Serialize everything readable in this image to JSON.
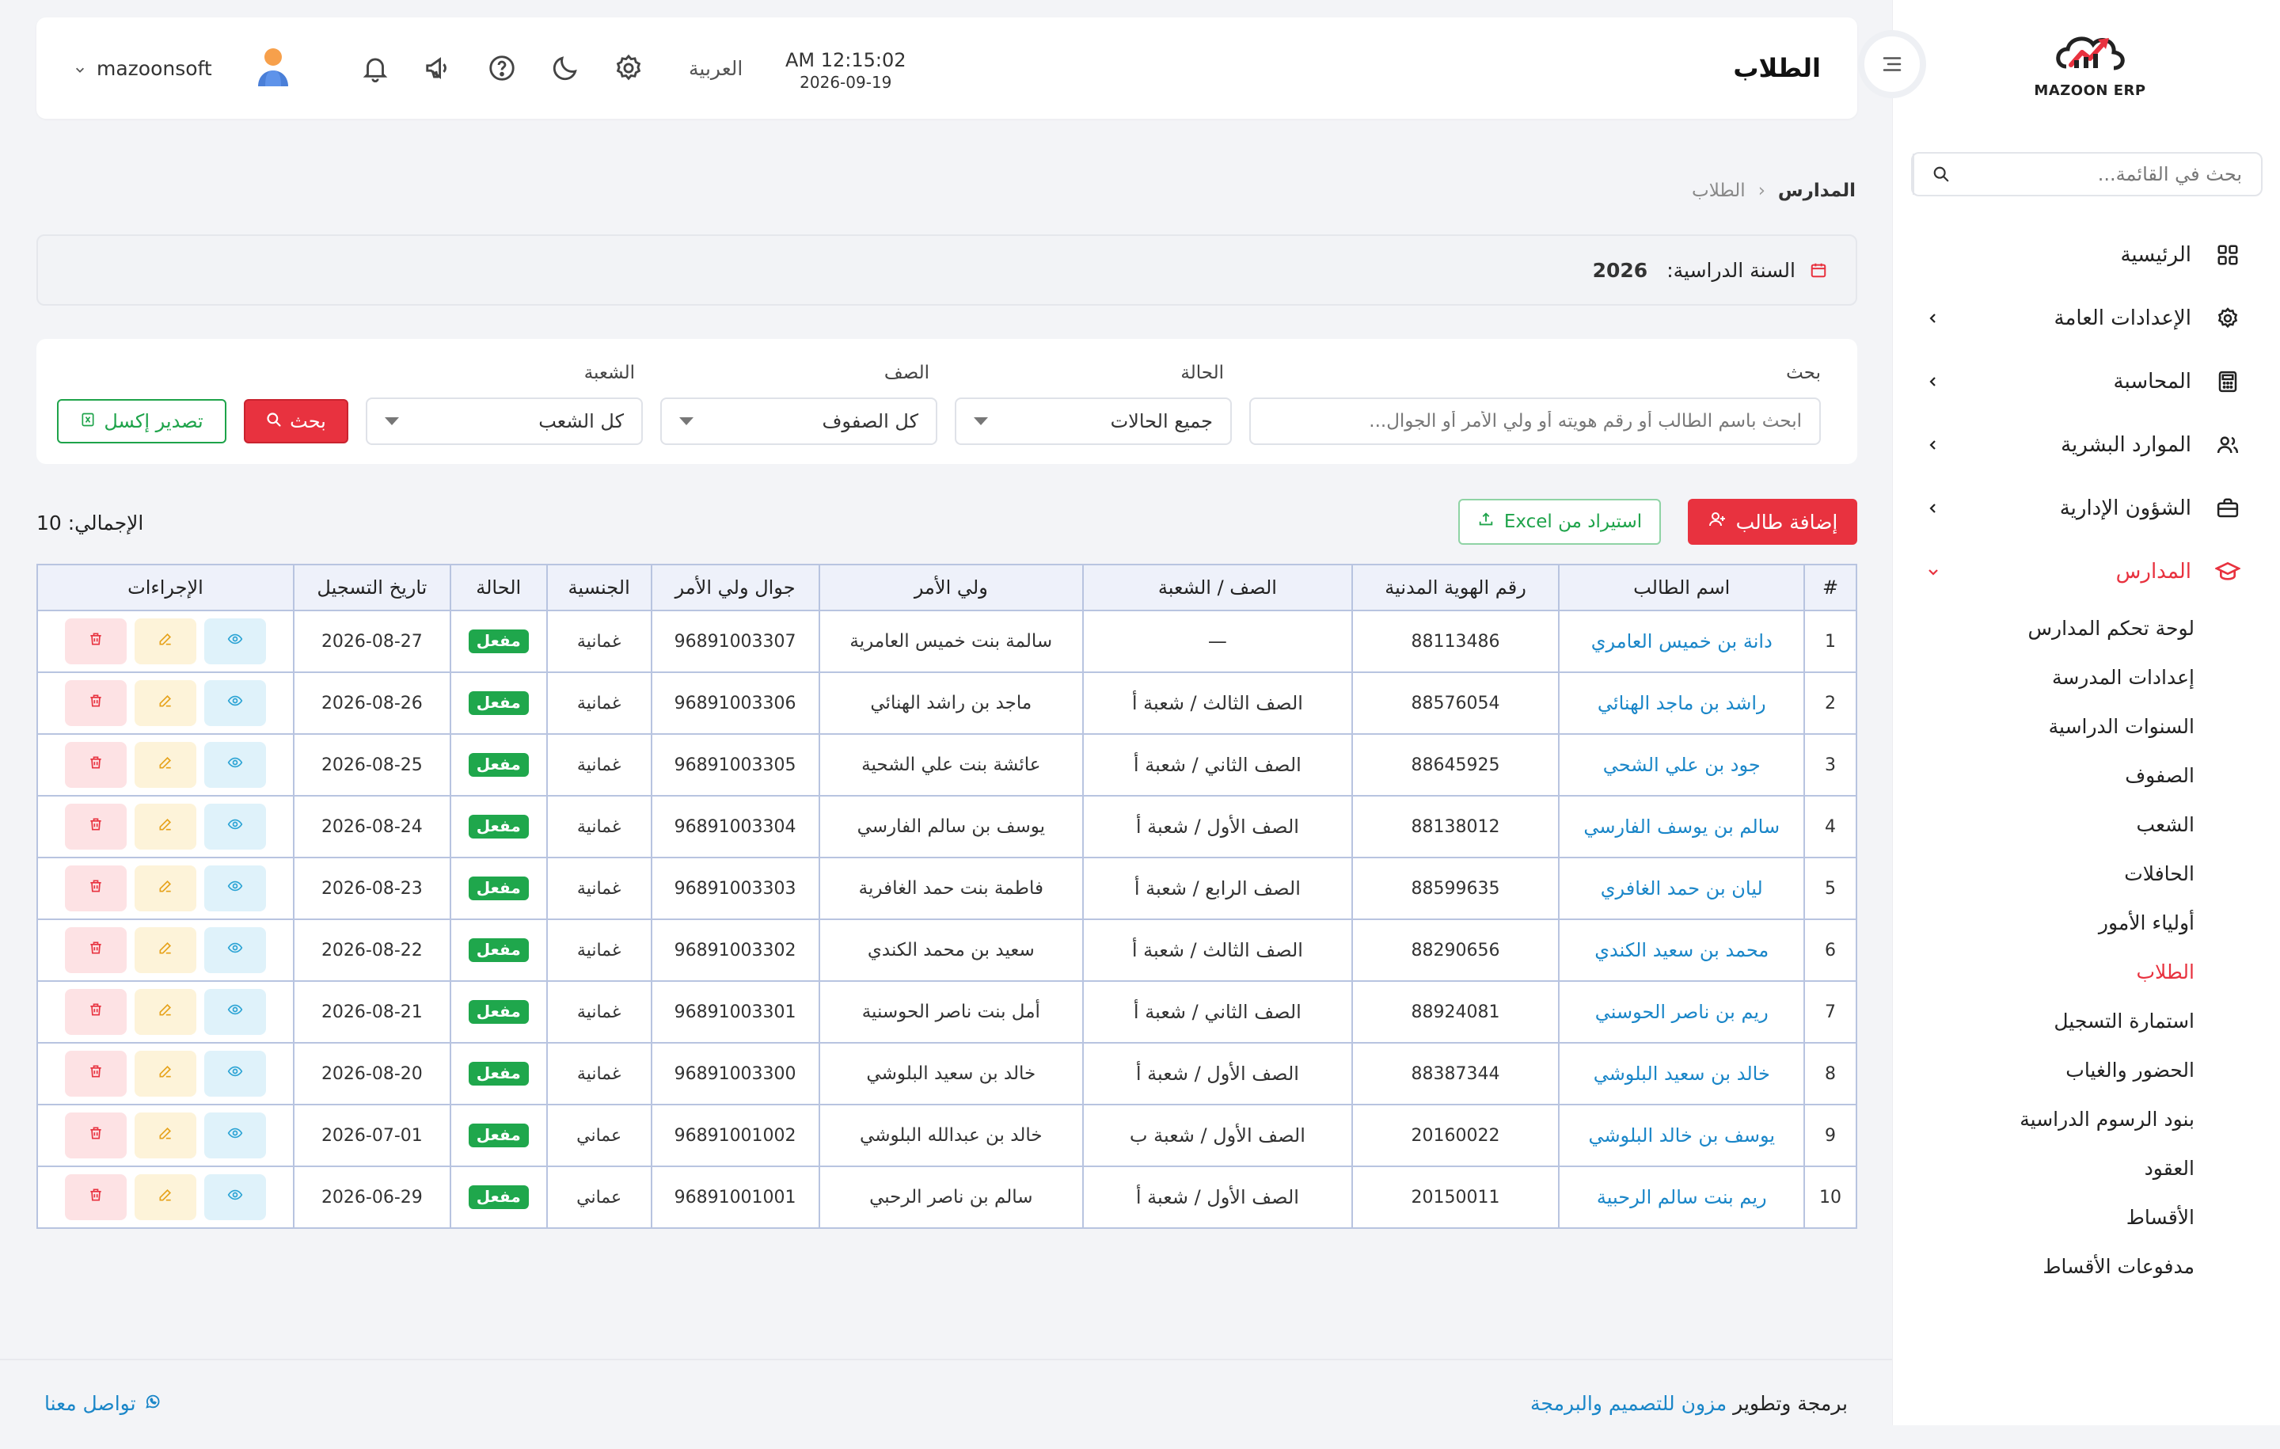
{
  "brand": {
    "name": "MAZOON ERP",
    "tagline": "ERP"
  },
  "colors": {
    "accent": "#e8323f",
    "success": "#1fa74c",
    "link": "#1a86c8",
    "header_row": "#eef1fa"
  },
  "sidebar": {
    "search_placeholder": "بحث في القائمة...",
    "items": [
      {
        "label": "الرئيسية",
        "icon": "grid-icon",
        "has_children": false
      },
      {
        "label": "الإعدادات العامة",
        "icon": "gear-icon",
        "has_children": true
      },
      {
        "label": "المحاسبة",
        "icon": "calculator-icon",
        "has_children": true
      },
      {
        "label": "الموارد البشرية",
        "icon": "users-icon",
        "has_children": true
      },
      {
        "label": "الشؤون الإدارية",
        "icon": "briefcase-icon",
        "has_children": true
      },
      {
        "label": "المدارس",
        "icon": "graduation-cap-icon",
        "has_children": true,
        "expanded": true
      }
    ],
    "schools_sub": [
      "لوحة تحكم المدارس",
      "إعدادات المدرسة",
      "السنوات الدراسية",
      "الصفوف",
      "الشعب",
      "الحافلات",
      "أولياء الأمور",
      "الطلاب",
      "استمارة التسجيل",
      "الحضور والغياب",
      "بنود الرسوم الدراسية",
      "العقود",
      "الأقساط",
      "مدفوعات الأقساط"
    ],
    "active_sub": "الطلاب"
  },
  "topbar": {
    "title": "الطلاب",
    "time": "AM 12:15:02",
    "date": "2026-09-19",
    "language": "العربية",
    "username": "mazoonsoft"
  },
  "breadcrumb": {
    "root": "المدارس",
    "current": "الطلاب"
  },
  "year": {
    "label": "السنة الدراسية:",
    "value": "2026"
  },
  "filters": {
    "search_label": "بحث",
    "search_placeholder": "ابحث باسم الطالب أو رقم هويته أو ولي الأمر أو الجوال...",
    "status_label": "الحالة",
    "status_value": "جميع الحالات",
    "class_label": "الصف",
    "class_value": "كل الصفوف",
    "section_label": "الشعبة",
    "section_value": "كل الشعب",
    "search_button": "بحث",
    "export_button": "تصدير إكسل"
  },
  "actions": {
    "add_button": "إضافة طالب",
    "import_button": "استيراد من Excel",
    "total": "الإجمالي: 10"
  },
  "table": {
    "headers": [
      "#",
      "اسم الطالب",
      "رقم الهوية المدنية",
      "الصف / الشعبة",
      "ولي الأمر",
      "جوال ولي الأمر",
      "الجنسية",
      "الحالة",
      "تاريخ التسجيل",
      "الإجراءات"
    ],
    "rows": [
      {
        "n": "1",
        "name": "دانة بن خميس العامري",
        "id": "88113486",
        "cls": "—",
        "guardian": "سالمة بنت خميس العامرية",
        "phone": "96891003307",
        "nat": "غمانية",
        "status": "مفعل",
        "date": "2026-08-27"
      },
      {
        "n": "2",
        "name": "راشد بن ماجد الهنائي",
        "id": "88576054",
        "cls": "الصف الثالث  /  شعبة أ",
        "guardian": "ماجد بن راشد الهنائي",
        "phone": "96891003306",
        "nat": "غمانية",
        "status": "مفعل",
        "date": "2026-08-26"
      },
      {
        "n": "3",
        "name": "جود بن علي الشحي",
        "id": "88645925",
        "cls": "الصف الثاني  /  شعبة أ",
        "guardian": "عائشة بنت علي الشحية",
        "phone": "96891003305",
        "nat": "غمانية",
        "status": "مفعل",
        "date": "2026-08-25"
      },
      {
        "n": "4",
        "name": "سالم بن يوسف الفارسي",
        "id": "88138012",
        "cls": "الصف الأول  /  شعبة أ",
        "guardian": "يوسف بن سالم الفارسي",
        "phone": "96891003304",
        "nat": "غمانية",
        "status": "مفعل",
        "date": "2026-08-24"
      },
      {
        "n": "5",
        "name": "ليان بن حمد الغافري",
        "id": "88599635",
        "cls": "الصف الرابع  /  شعبة أ",
        "guardian": "فاطمة بنت حمد الغافرية",
        "phone": "96891003303",
        "nat": "غمانية",
        "status": "مفعل",
        "date": "2026-08-23"
      },
      {
        "n": "6",
        "name": "محمد بن سعيد الكندي",
        "id": "88290656",
        "cls": "الصف الثالث  /  شعبة أ",
        "guardian": "سعيد بن محمد الكندي",
        "phone": "96891003302",
        "nat": "غمانية",
        "status": "مفعل",
        "date": "2026-08-22"
      },
      {
        "n": "7",
        "name": "ريم بن ناصر الحوسني",
        "id": "88924081",
        "cls": "الصف الثاني  /  شعبة أ",
        "guardian": "أمل بنت ناصر الحوسنية",
        "phone": "96891003301",
        "nat": "غمانية",
        "status": "مفعل",
        "date": "2026-08-21"
      },
      {
        "n": "8",
        "name": "خالد بن سعيد البلوشي",
        "id": "88387344",
        "cls": "الصف الأول  /  شعبة أ",
        "guardian": "خالد بن سعيد البلوشي",
        "phone": "96891003300",
        "nat": "غمانية",
        "status": "مفعل",
        "date": "2026-08-20"
      },
      {
        "n": "9",
        "name": "يوسف بن خالد البلوشي",
        "id": "20160022",
        "cls": "الصف الأول  /  شعبة ب",
        "guardian": "خالد بن عبدالله البلوشي",
        "phone": "96891001002",
        "nat": "عماني",
        "status": "مفعل",
        "date": "2026-07-01"
      },
      {
        "n": "10",
        "name": "ريم بنت سالم الرحبية",
        "id": "20150011",
        "cls": "الصف الأول  /  شعبة أ",
        "guardian": "سالم بن ناصر الرحبي",
        "phone": "96891001001",
        "nat": "عماني",
        "status": "مفعل",
        "date": "2026-06-29"
      }
    ]
  },
  "footer": {
    "credit_prefix": "برمجة وتطوير",
    "credit_link": "مزون للتصميم والبرمجة",
    "contact": "تواصل معنا"
  }
}
